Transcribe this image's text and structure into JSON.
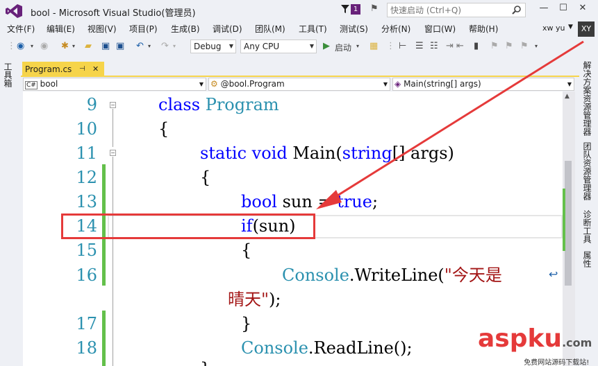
{
  "window": {
    "title": "bool - Microsoft Visual Studio(管理员)",
    "notif_count": "1",
    "quicklaunch_placeholder": "快速启动 (Ctrl+Q)",
    "minimize": "—",
    "maximize": "☐",
    "close": "✕"
  },
  "menu": [
    "文件(F)",
    "编辑(E)",
    "视图(V)",
    "项目(P)",
    "生成(B)",
    "调试(D)",
    "团队(M)",
    "工具(T)",
    "测试(S)",
    "分析(N)",
    "窗口(W)",
    "帮助(H)"
  ],
  "user": {
    "name": "xw yu",
    "initials": "XY"
  },
  "toolbar": {
    "config": "Debug",
    "platform": "Any CPU",
    "start": "启动"
  },
  "left_rail": {
    "toolbox": "工具箱"
  },
  "tab": {
    "name": "Program.cs",
    "pin": "⊣",
    "close": "✕"
  },
  "nav": {
    "project": "bool",
    "class": "@bool.Program",
    "member": "Main(string[] args)"
  },
  "right_rail": [
    "解决方案资源管理器",
    "团队资源管理器",
    "诊断工具",
    "属性"
  ],
  "lines": [
    {
      "num": "9",
      "parts": [
        {
          "t": "class ",
          "c": "kw"
        },
        {
          "t": "Program",
          "c": "ty"
        }
      ]
    },
    {
      "num": "10",
      "parts": [
        {
          "t": "{",
          "c": ""
        }
      ]
    },
    {
      "num": "11",
      "parts": [
        {
          "t": "static ",
          "c": "kw"
        },
        {
          "t": "void ",
          "c": "kw"
        },
        {
          "t": "Main(",
          "c": ""
        },
        {
          "t": "string",
          "c": "kw"
        },
        {
          "t": "[] args)",
          "c": ""
        }
      ]
    },
    {
      "num": "12",
      "parts": [
        {
          "t": "{",
          "c": ""
        }
      ]
    },
    {
      "num": "13",
      "parts": [
        {
          "t": "bool ",
          "c": "kw"
        },
        {
          "t": "sun = ",
          "c": ""
        },
        {
          "t": "true",
          "c": "kw"
        },
        {
          "t": ";",
          "c": ""
        }
      ]
    },
    {
      "num": "14",
      "parts": [
        {
          "t": "if",
          "c": "kw"
        },
        {
          "t": "(sun)",
          "c": ""
        }
      ]
    },
    {
      "num": "15",
      "parts": [
        {
          "t": "{",
          "c": ""
        }
      ]
    },
    {
      "num": "16",
      "parts": [
        {
          "t": "Console",
          "c": "ty"
        },
        {
          "t": ".WriteLine(",
          "c": ""
        },
        {
          "t": "\"今天是",
          "c": "str"
        }
      ]
    },
    {
      "num": "",
      "parts": [
        {
          "t": "晴天\"",
          "c": "str"
        },
        {
          "t": ");",
          "c": ""
        }
      ]
    },
    {
      "num": "17",
      "parts": [
        {
          "t": "}",
          "c": ""
        }
      ]
    },
    {
      "num": "18",
      "parts": [
        {
          "t": "Console",
          "c": "ty"
        },
        {
          "t": ".ReadLine();",
          "c": ""
        }
      ]
    },
    {
      "num": "",
      "parts": [
        {
          "t": "}",
          "c": ""
        }
      ]
    }
  ],
  "watermark": {
    "brand": "aspku",
    "suffix": ".com",
    "tagline": "免费网站源码下载站!"
  },
  "colors": {
    "accent": "#68217a",
    "tab": "#f6d44a",
    "highlight": "#e53a3a",
    "changed": "#64c04b"
  }
}
